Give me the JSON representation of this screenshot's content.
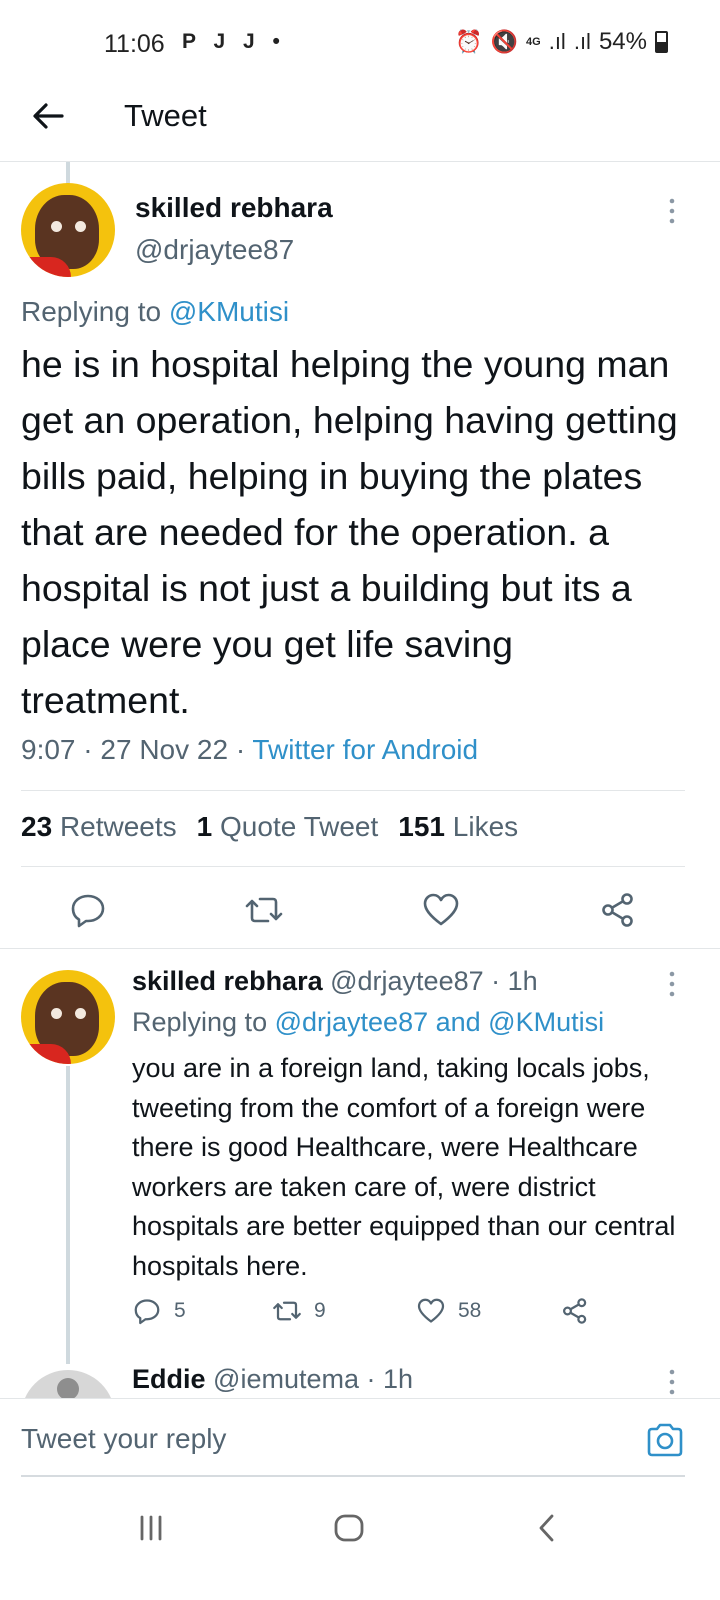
{
  "status_bar": {
    "time": "11:06",
    "notification_icons": "P J J •",
    "network": "4G",
    "battery": "54%"
  },
  "header": {
    "title": "Tweet"
  },
  "main_tweet": {
    "name": "skilled rebhara",
    "handle": "@drjaytee87",
    "replying_prefix": "Replying to",
    "replying_to": "@KMutisi",
    "text": "he is in hospital helping the young man get an operation, helping having getting bills paid, helping in buying the plates that are needed for the operation. a hospital is not just a building but its a place were you get life saving treatment.",
    "time": "9:07",
    "date": "27 Nov 22",
    "source": "Twitter for Android",
    "retweets": "23",
    "retweets_label": "Retweets",
    "quotes": "1",
    "quotes_label": "Quote Tweet",
    "likes": "151",
    "likes_label": "Likes"
  },
  "reply": {
    "name": "skilled rebhara",
    "handle": "@drjaytee87",
    "age": "· 1h",
    "replying_prefix": "Replying to",
    "replying_to": "@drjaytee87 and @KMutisi",
    "text": "you are in a foreign land, taking locals jobs, tweeting from the comfort of a foreign were there is good Healthcare, were Healthcare workers are taken care of, were district hospitals are better equipped than our central hospitals here.",
    "replies": "5",
    "retweets": "9",
    "likes": "58"
  },
  "next_reply": {
    "name": "Eddie",
    "handle": "@iemutema",
    "age": "· 1h"
  },
  "compose": {
    "placeholder": "Tweet your reply"
  },
  "colors": {
    "link": "#2f90c9",
    "secondary_text": "#536471",
    "avatar_bg": "#f4c20d"
  }
}
